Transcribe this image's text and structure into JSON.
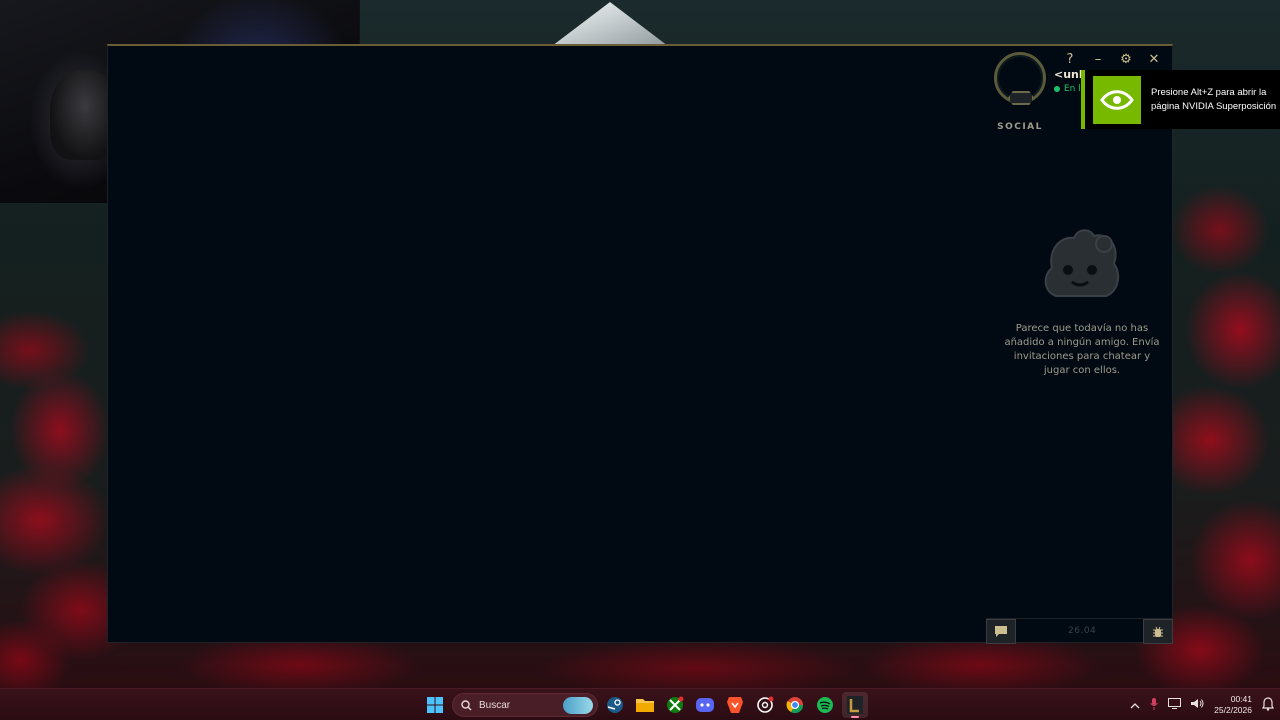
{
  "client": {
    "window_controls": {
      "help": "?",
      "minimize": "–",
      "settings": "⚙",
      "close": "✕"
    },
    "social": {
      "label": "SOCIAL",
      "player_name": "<unk",
      "status": "En l"
    },
    "friends": {
      "empty_message": "Parece que todavía no has añadido a ningún amigo. Envía invitaciones para chatear y jugar con ellos."
    },
    "footer": {
      "version": "26.04"
    }
  },
  "nvidia_toast": {
    "message": "Presione Alt+Z para abrir la página NVIDIA Superposición"
  },
  "taskbar": {
    "search_placeholder": "Buscar",
    "apps": [
      "windows-start-icon",
      "steam-icon",
      "file-explorer-icon",
      "xbox-icon",
      "discord-icon",
      "brave-icon",
      "chatgpt-icon",
      "chrome-icon",
      "spotify-icon",
      "league-client-icon"
    ],
    "clock_time": "00:41",
    "clock_date": "25/2/2026"
  },
  "colors": {
    "client_bg": "#010a13",
    "gold": "#cdbe91",
    "online_green": "#1ec06c",
    "nvidia_green": "#76b900",
    "taskbar_bg": "#3a1119"
  }
}
